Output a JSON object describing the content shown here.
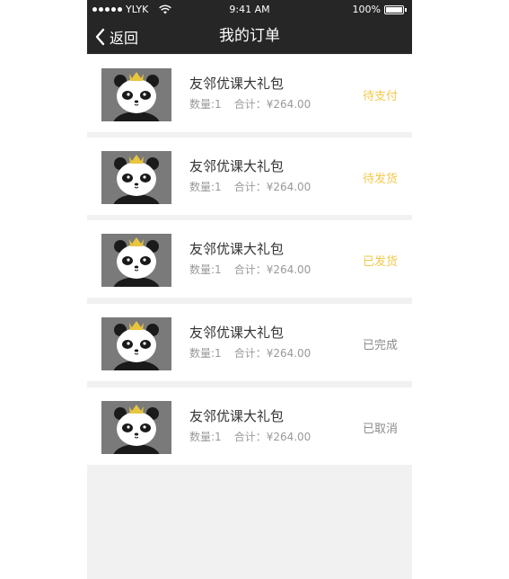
{
  "status_bar": {
    "carrier": "YLYK",
    "time": "9:41 AM",
    "battery": "100%"
  },
  "nav": {
    "back_label": "返回",
    "title": "我的订单"
  },
  "colors": {
    "bar_bg": "#262626",
    "page_bg": "#f1f1f1",
    "accent_yellow": "#f2c94c",
    "muted_gray": "#8c8c8c"
  },
  "orders": [
    {
      "name": "友邻优课大礼包",
      "qty": "数量:1",
      "total": "合计：¥264.00",
      "status": "待支付",
      "status_color": "#f2c94c"
    },
    {
      "name": "友邻优课大礼包",
      "qty": "数量:1",
      "total": "合计：¥264.00",
      "status": "待发货",
      "status_color": "#f2c94c"
    },
    {
      "name": "友邻优课大礼包",
      "qty": "数量:1",
      "total": "合计：¥264.00",
      "status": "已发货",
      "status_color": "#f2c94c"
    },
    {
      "name": "友邻优课大礼包",
      "qty": "数量:1",
      "total": "合计：¥264.00",
      "status": "已完成",
      "status_color": "#8c8c8c"
    },
    {
      "name": "友邻优课大礼包",
      "qty": "数量:1",
      "total": "合计：¥264.00",
      "status": "已取消",
      "status_color": "#8c8c8c"
    }
  ]
}
